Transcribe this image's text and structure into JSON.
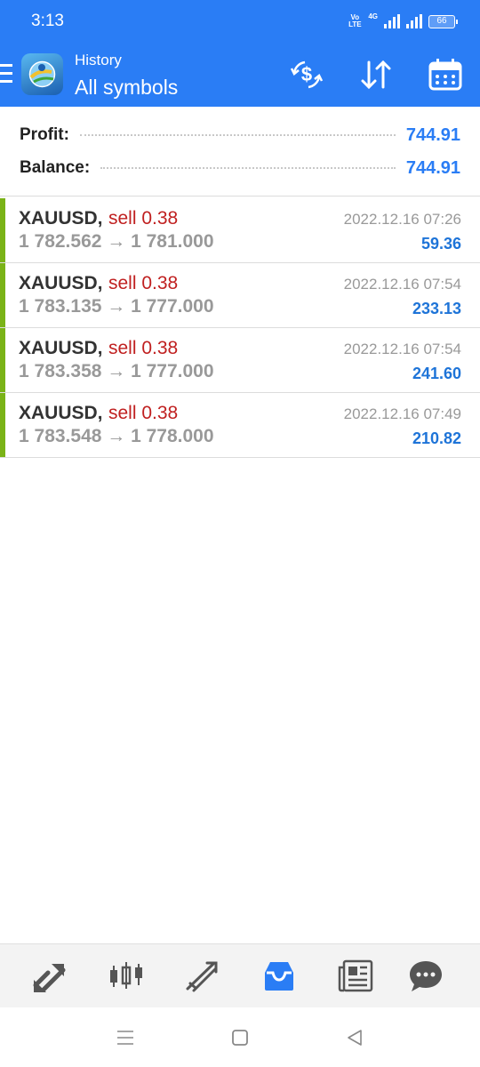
{
  "status_bar": {
    "time": "3:13",
    "volte": "Vo LTE",
    "network": "4G",
    "battery": "66"
  },
  "header": {
    "subtitle": "History",
    "title": "All symbols",
    "icons": [
      "menu-icon",
      "metatrader-logo",
      "currency-exchange-icon",
      "sort-icon",
      "calendar-icon"
    ]
  },
  "summary": {
    "profit_label": "Profit:",
    "profit_value": "744.91",
    "balance_label": "Balance:",
    "balance_value": "744.91"
  },
  "trades": [
    {
      "symbol": "XAUUSD,",
      "side": "sell 0.38",
      "prices": "1 782.562 → 1 781.000",
      "datetime": "2022.12.16 07:26",
      "profit": "59.36"
    },
    {
      "symbol": "XAUUSD,",
      "side": "sell 0.38",
      "prices": "1 783.135 → 1 777.000",
      "datetime": "2022.12.16 07:54",
      "profit": "233.13"
    },
    {
      "symbol": "XAUUSD,",
      "side": "sell 0.38",
      "prices": "1 783.358 → 1 777.000",
      "datetime": "2022.12.16 07:54",
      "profit": "241.60"
    },
    {
      "symbol": "XAUUSD,",
      "side": "sell 0.38",
      "prices": "1 783.548 → 1 778.000",
      "datetime": "2022.12.16 07:49",
      "profit": "210.82"
    }
  ],
  "bottom_nav": {
    "items": [
      "quotes-icon",
      "chart-icon",
      "trade-icon",
      "history-icon",
      "news-icon",
      "chat-icon"
    ],
    "active": "history-icon"
  },
  "colors": {
    "accent": "#2a7df5",
    "sell": "#c02020",
    "profit": "#1e74d8",
    "trade_bar": "#7ab317"
  }
}
